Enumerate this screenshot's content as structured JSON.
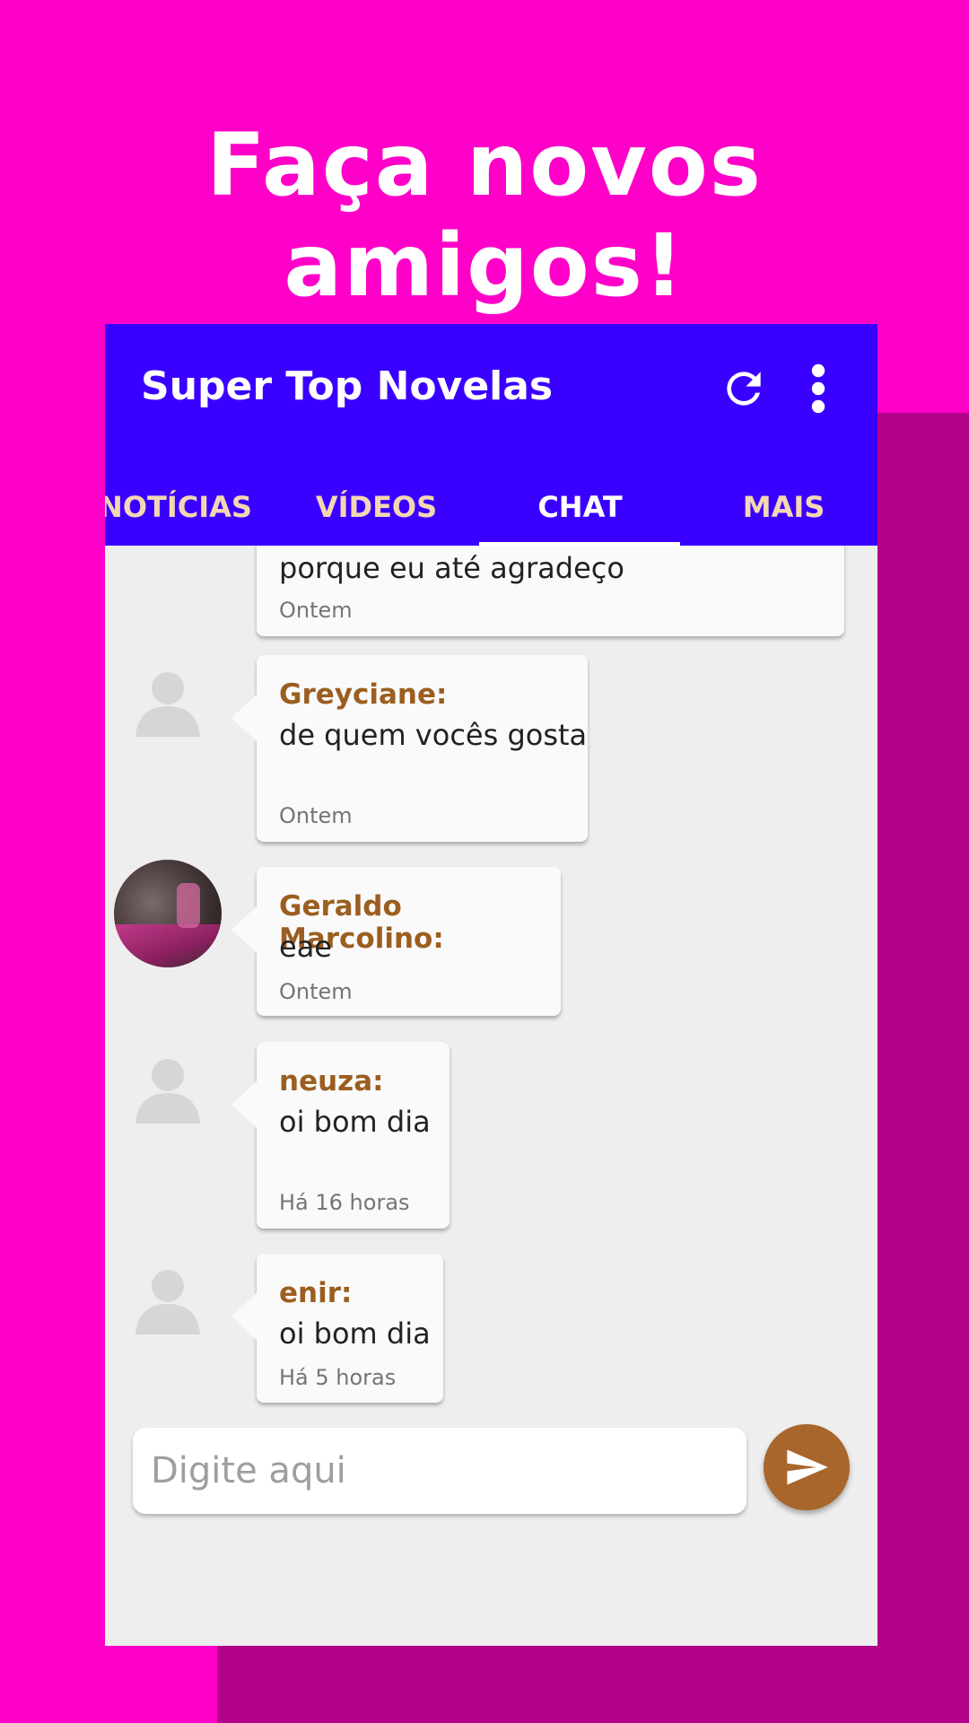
{
  "headline": "Faça novos amigos!",
  "app": {
    "title": "Super Top Novelas",
    "icons": {
      "refresh": "refresh-icon",
      "menu": "more-vert-icon"
    }
  },
  "tabs": [
    {
      "label": "NOTÍCIAS",
      "active": false
    },
    {
      "label": "VÍDEOS",
      "active": false
    },
    {
      "label": "CHAT",
      "active": true
    },
    {
      "label": "MAIS",
      "active": false
    }
  ],
  "messages": [
    {
      "sender": "",
      "text": "porque eu até agradeço",
      "time": "Ontem",
      "avatar": "none"
    },
    {
      "sender": "Greyciane:",
      "text": "de quem vocês gosta",
      "time": "Ontem",
      "avatar": "default-user-icon"
    },
    {
      "sender": "Geraldo Marcolino:",
      "text": "eae",
      "time": "Ontem",
      "avatar": "photo"
    },
    {
      "sender": "neuza:",
      "text": "oi bom dia",
      "time": "Há 16 horas",
      "avatar": "default-user-icon"
    },
    {
      "sender": "enir:",
      "text": "oi bom dia",
      "time": "Há 5 horas",
      "avatar": "default-user-icon"
    }
  ],
  "composer": {
    "placeholder": "Digite aqui",
    "send_icon": "send-icon"
  },
  "colors": {
    "background": "#ff00c8",
    "background_accent": "#b20088",
    "appbar": "#3a00ff",
    "sender_name": "#9b5e20",
    "send_button": "#a8662c"
  }
}
